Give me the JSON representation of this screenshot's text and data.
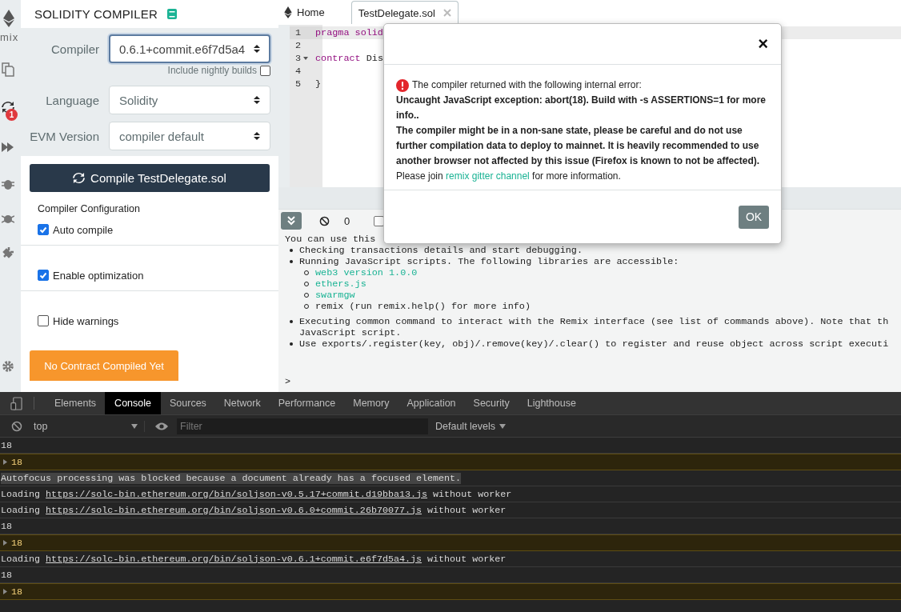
{
  "icon_rail": {
    "logo_text": "mix",
    "badge": "1"
  },
  "side_panel": {
    "title": "SOLIDITY COMPILER",
    "fields": [
      {
        "label": "Compiler",
        "value": "0.6.1+commit.e6f7d5a4",
        "focused": true
      },
      {
        "label": "Language",
        "value": "Solidity",
        "focused": false
      },
      {
        "label": "EVM Version",
        "value": "compiler default",
        "focused": false
      }
    ],
    "nightly": {
      "label": "Include nightly builds",
      "checked": false
    },
    "compile_button": "Compile TestDelegate.sol",
    "config_title": "Compiler Configuration",
    "options": [
      {
        "label": "Auto compile",
        "checked": true
      },
      {
        "label": "Enable optimization",
        "checked": true
      },
      {
        "label": "Hide warnings",
        "checked": false
      }
    ],
    "status_button": "No Contract Compiled Yet"
  },
  "editor": {
    "tabs": [
      {
        "label": "Home",
        "kind": "home",
        "selected": false
      },
      {
        "label": "TestDelegate.sol",
        "kind": "file",
        "selected": true
      }
    ],
    "lines": [
      {
        "number": "1",
        "fold": false,
        "tokens": [
          {
            "text": "pragma solid",
            "kind": "keyword"
          }
        ]
      },
      {
        "number": "2",
        "fold": false
      },
      {
        "number": "3",
        "fold": true,
        "tokens": [
          {
            "text": "contract",
            "kind": "keyword"
          },
          {
            "text": " Dis",
            "kind": "plain"
          }
        ]
      },
      {
        "number": "4",
        "fold": false
      },
      {
        "number": "5",
        "fold": false,
        "tokens": [
          {
            "text": "}",
            "kind": "plain"
          }
        ]
      }
    ]
  },
  "terminal": {
    "count": "0",
    "listen_checked": false,
    "intro": "You can use this",
    "items": [
      {
        "text": "Checking transactions details and start debugging."
      },
      {
        "text": "Running JavaScript scripts. The following libraries are accessible:",
        "children": [
          {
            "text": "web3 version 1.0.0",
            "link": true
          },
          {
            "text": "ethers.js",
            "link": true
          },
          {
            "text": "swarmgw",
            "link": true
          },
          {
            "text": "remix (run remix.help() for more info)",
            "link": false
          }
        ]
      },
      {
        "text": "Executing common command to interact with the Remix interface (see list of commands above). Note that th",
        "continuation": "JavaScript script."
      },
      {
        "text": "Use exports/.register(key, obj)/.remove(key)/.clear() to register and reuse object across script executi"
      }
    ],
    "prompt": ">"
  },
  "dialog": {
    "close": "×",
    "intro": "The compiler returned with the following internal error:",
    "error": "Uncaught JavaScript exception: abort(18). Build with -s ASSERTIONS=1 for more info..",
    "warning": "The compiler might be in a non-sane state, please be careful and do not use further compilation data to deploy to mainnet. It is heavily recommended to use another browser not affected by this issue (Firefox is known to not be affected).",
    "join_before": "Please join ",
    "join_link": "remix gitter channel",
    "join_after": " for more information.",
    "ok": "OK"
  },
  "devtools": {
    "tabs": [
      {
        "label": "Elements",
        "selected": false
      },
      {
        "label": "Console",
        "selected": true
      },
      {
        "label": "Sources",
        "selected": false
      },
      {
        "label": "Network",
        "selected": false
      },
      {
        "label": "Performance",
        "selected": false
      },
      {
        "label": "Memory",
        "selected": false
      },
      {
        "label": "Application",
        "selected": false
      },
      {
        "label": "Security",
        "selected": false
      },
      {
        "label": "Lighthouse",
        "selected": false
      }
    ],
    "context": "top",
    "filter_placeholder": "Filter",
    "levels": "Default levels",
    "messages": [
      {
        "kind": "log",
        "text": "18"
      },
      {
        "kind": "warning",
        "text": "18"
      },
      {
        "kind": "highlight",
        "text": "Autofocus processing was blocked because a document already has a focused element."
      },
      {
        "kind": "load",
        "text": "Loading",
        "url": "https://solc-bin.ethereum.org/bin/soljson-v0.5.17+commit.d19bba13.js",
        "suffix": "without worker"
      },
      {
        "kind": "load",
        "text": "Loading",
        "url": "https://solc-bin.ethereum.org/bin/soljson-v0.6.0+commit.26b70077.js",
        "suffix": "without worker"
      },
      {
        "kind": "log",
        "text": "18"
      },
      {
        "kind": "warning",
        "text": "18"
      },
      {
        "kind": "load",
        "text": "Loading",
        "url": "https://solc-bin.ethereum.org/bin/soljson-v0.6.1+commit.e6f7d5a4.js",
        "suffix": "without worker"
      },
      {
        "kind": "log",
        "text": "18"
      },
      {
        "kind": "warning",
        "text": "18"
      }
    ]
  }
}
